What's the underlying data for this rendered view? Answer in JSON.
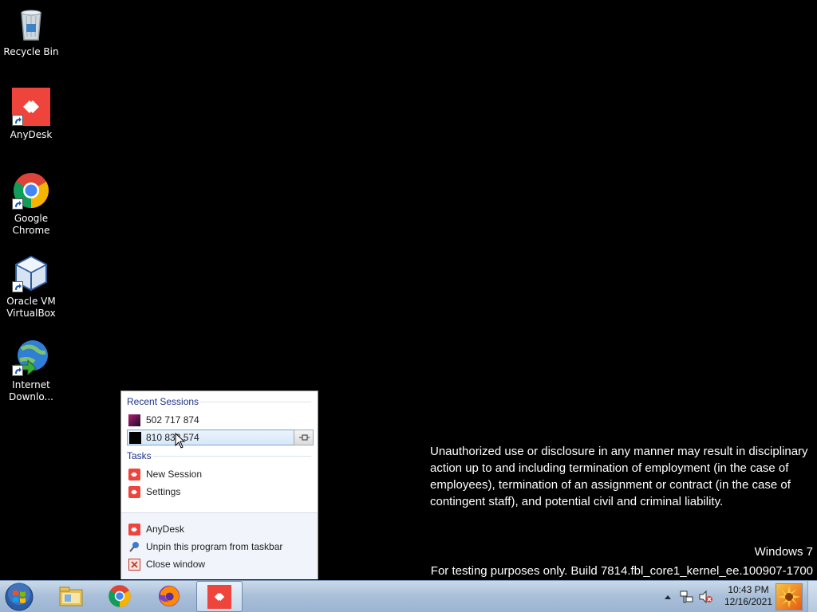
{
  "desktop": {
    "icons": [
      {
        "label": "Recycle Bin",
        "icon": "recycle-bin-icon"
      },
      {
        "label": "AnyDesk",
        "icon": "anydesk-icon"
      },
      {
        "label": "Google Chrome",
        "icon": "chrome-icon"
      },
      {
        "label": "Oracle VM VirtualBox",
        "icon": "virtualbox-icon"
      },
      {
        "label": "Internet Downlo...",
        "icon": "internet-download-manager-icon"
      }
    ],
    "notice": "Unauthorized use or disclosure in any manner may result in disciplinary action up to and including termination of employment (in the case of employees), termination of an assignment or contract (in the case of contingent staff), and potential civil and criminal liability.",
    "windows_label": "Windows 7",
    "build_label": "For testing purposes only. Build 7814.fbl_core1_kernel_ee.100907-1700"
  },
  "jumplist": {
    "recent_header": "Recent Sessions",
    "recent": [
      {
        "label": "502 717 874"
      },
      {
        "label": "810 833 574"
      }
    ],
    "tasks_header": "Tasks",
    "tasks": [
      {
        "label": "New Session"
      },
      {
        "label": "Settings"
      }
    ],
    "bottom": [
      {
        "label": "AnyDesk"
      },
      {
        "label": "Unpin this program from taskbar"
      },
      {
        "label": "Close window"
      }
    ]
  },
  "taskbar": {
    "pinned": [
      "explorer-icon",
      "chrome-icon",
      "firefox-icon",
      "anydesk-icon"
    ],
    "active": "anydesk-icon",
    "clock_time": "10:43 PM",
    "clock_date": "12/16/2021"
  },
  "colors": {
    "anydesk_red": "#ef443b",
    "taskbar": "#a9bfd8"
  }
}
